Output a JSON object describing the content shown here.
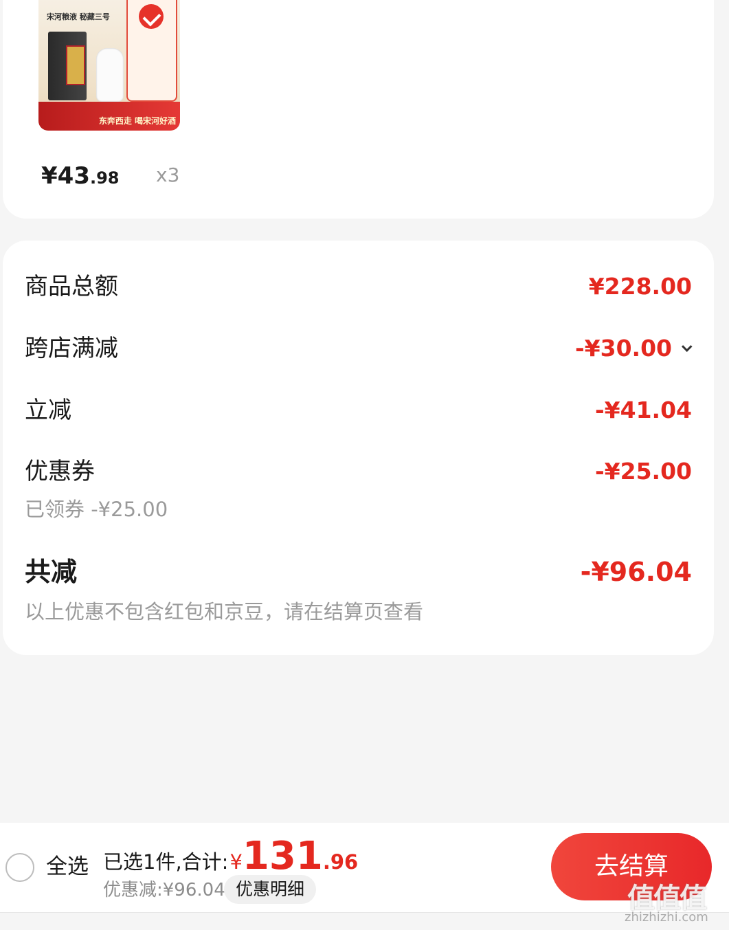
{
  "product": {
    "thumb_brand": "宋河粮液 秘藏三号",
    "thumb_slogan": "东奔西走 喝宋河好酒",
    "price_int": "¥43",
    "price_dec": ".98",
    "quantity": "x3"
  },
  "summary": {
    "items": [
      {
        "label": "商品总额",
        "value": "¥228.00"
      },
      {
        "label": "跨店满减",
        "value": "-¥30.00"
      },
      {
        "label": "立减",
        "value": "-¥41.04"
      },
      {
        "label": "优惠券",
        "value": "-¥25.00",
        "sub": "已领券 -¥25.00"
      }
    ],
    "total_label": "共减",
    "total_value": "-¥96.04",
    "note": "以上优惠不包含红包和京豆，请在结算页查看"
  },
  "bottom_bar": {
    "select_all": "全选",
    "selected_text": "已选1件,合计:",
    "currency": "¥",
    "total_int": "131",
    "total_dec": ".96",
    "discount_text": "优惠减:¥96.04",
    "discount_detail": "优惠明细",
    "checkout": "去结算"
  },
  "watermark": {
    "logo": "值值值",
    "url": "zhizhizhi.com"
  },
  "colors": {
    "accent_red": "#e4281f",
    "background": "#f5f5f5"
  }
}
